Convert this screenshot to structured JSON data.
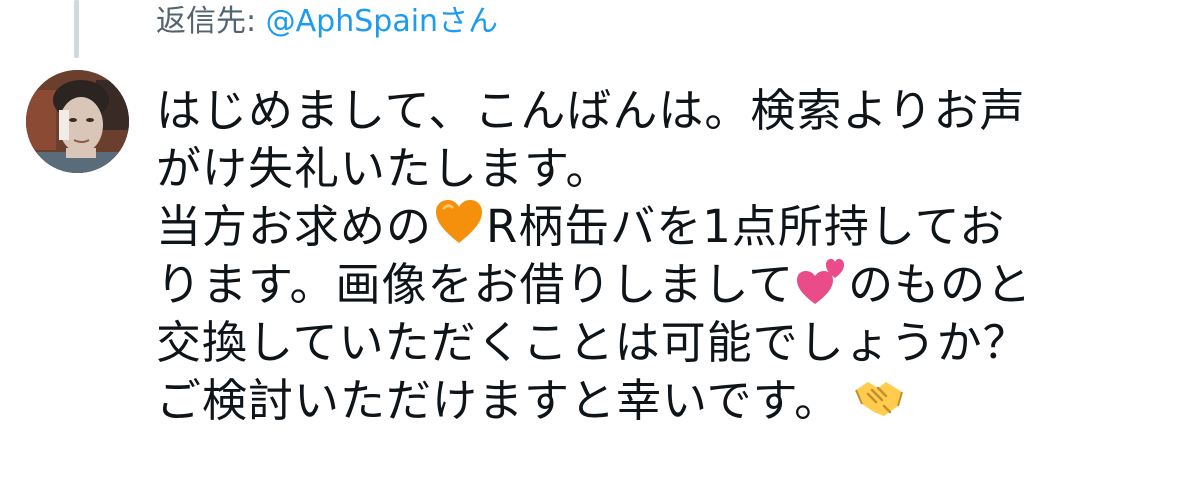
{
  "reply": {
    "label": "返信先: ",
    "handle": "@AphSpain",
    "suffix": "さん"
  },
  "avatar": {
    "icon": "user-avatar"
  },
  "tweet": {
    "lines": [
      {
        "before": "はじめまして、こんばんは。検索よりお声",
        "emoji": null,
        "after": ""
      },
      {
        "before": "がけ失礼いたします。",
        "emoji": null,
        "after": ""
      },
      {
        "before": "当方お求めの",
        "emoji": "orange-heart-icon",
        "after": "R柄缶バを1点所持してお"
      },
      {
        "before": "ります。画像をお借りしまして",
        "emoji": "two-hearts-icon",
        "after": "のものと"
      },
      {
        "before": "交換していただくことは可能でしょうか？",
        "emoji": null,
        "after": ""
      },
      {
        "before": "ご検討いただけますと幸いです。",
        "emoji": "handshake-icon",
        "after": ""
      }
    ]
  },
  "colors": {
    "text": "#0f1419",
    "secondary": "#536471",
    "link": "#1d9bf0",
    "thread_line": "#cfd9de"
  }
}
